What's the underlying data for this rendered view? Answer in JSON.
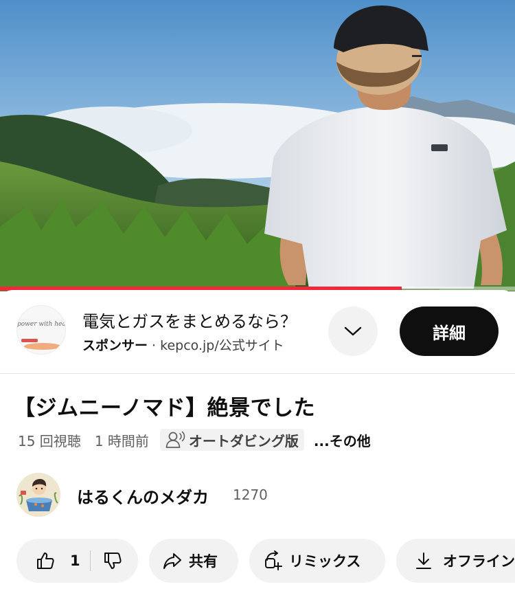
{
  "video": {
    "progress_fraction": 0.78,
    "accent_color": "#f1283a"
  },
  "ad": {
    "logo_text": "power with heart",
    "title": "電気とガスをまとめるなら？",
    "sponsor_label": "スポンサー",
    "separator": " · ",
    "domain": "kepco.jp/公式サイト",
    "details_label": "詳細"
  },
  "video_info": {
    "title": "【ジムニーノマド】絶景でした",
    "views": "15 回視聴",
    "time_ago": "1 時間前",
    "dub_label": "オートダビング版",
    "more_label": "...その他"
  },
  "channel": {
    "name": "はるくんのメダカ",
    "subscribers": "1270"
  },
  "actions": {
    "like_count": "1",
    "share_label": "共有",
    "remix_label": "リミックス",
    "offline_label": "オフライン"
  },
  "icons": [
    "chevron-down-icon",
    "user-voice-icon",
    "thumbs-up-icon",
    "thumbs-down-icon",
    "share-arrow-icon",
    "remix-icon",
    "download-icon"
  ]
}
